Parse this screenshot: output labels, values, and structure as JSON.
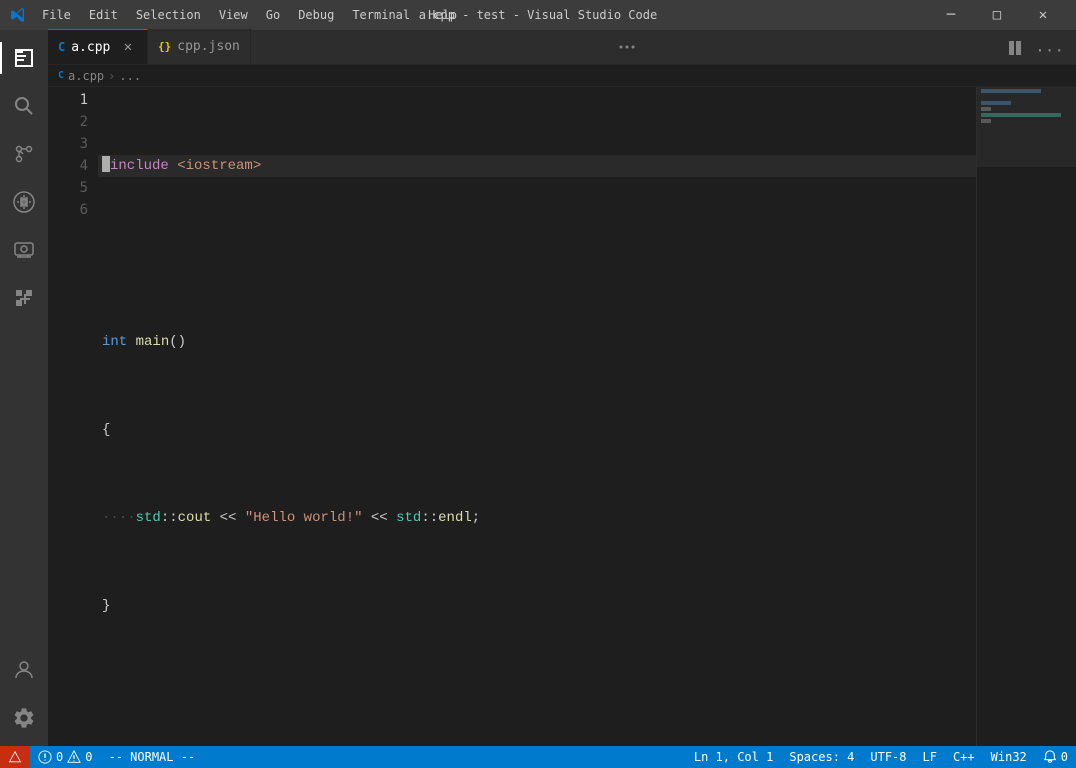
{
  "titlebar": {
    "title": "a.cpp - test - Visual Studio Code",
    "menu": [
      "File",
      "Edit",
      "Selection",
      "View",
      "Go",
      "Debug",
      "Terminal",
      "Help"
    ],
    "controls": {
      "minimize": "─",
      "maximize": "□",
      "close": "✕"
    }
  },
  "tabs": [
    {
      "id": "a-cpp",
      "label": "a.cpp",
      "icon_color": "#007acc",
      "icon_letter": "C",
      "active": true
    },
    {
      "id": "cpp-json",
      "label": "cpp.json",
      "icon_color": "#f1c40f",
      "icon_letter": "{}",
      "active": false
    }
  ],
  "breadcrumb": {
    "file": "a.cpp",
    "parts": [
      "a.cpp",
      ">",
      "..."
    ]
  },
  "code": {
    "lines": [
      {
        "num": 1,
        "content": "#include <iostream>"
      },
      {
        "num": 2,
        "content": ""
      },
      {
        "num": 3,
        "content": "int main()"
      },
      {
        "num": 4,
        "content": "{"
      },
      {
        "num": 5,
        "content": "    std::cout << \"Hello world!\" << std::endl;"
      },
      {
        "num": 6,
        "content": "}"
      }
    ]
  },
  "statusbar": {
    "errors": "0",
    "warnings": "0",
    "vim_mode": "-- NORMAL --",
    "position": "Ln 1, Col 1",
    "spaces": "Spaces: 4",
    "encoding": "UTF-8",
    "line_ending": "LF",
    "language": "C++",
    "platform": "Win32",
    "notifications": "0"
  },
  "activity": {
    "items": [
      "explorer",
      "search",
      "source-control",
      "extensions",
      "remote-explorer",
      "extensions-pack"
    ]
  },
  "icons": {
    "explorer": "⬜",
    "search": "🔍",
    "source_control": "⎇",
    "run_debug": "⚙",
    "remote": "🖥",
    "extensions": "⊞",
    "settings": "⚙",
    "accounts": "👤"
  }
}
